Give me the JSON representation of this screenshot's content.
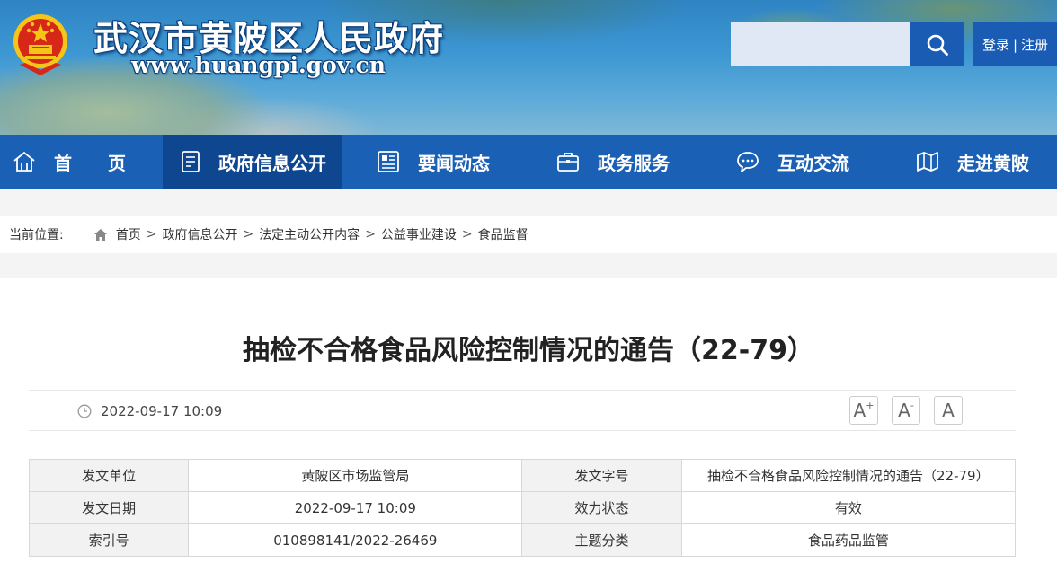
{
  "header": {
    "site_title": "武汉市黄陂区人民政府",
    "site_url": "www.huangpi.gov.cn",
    "search_placeholder": "",
    "login_label": "登录",
    "separator": "|",
    "register_label": "注册"
  },
  "nav": {
    "items": [
      {
        "label": "首　　页",
        "icon": "home-icon"
      },
      {
        "label": "政府信息公开",
        "icon": "document-icon"
      },
      {
        "label": "要闻动态",
        "icon": "news-icon"
      },
      {
        "label": "政务服务",
        "icon": "briefcase-icon"
      },
      {
        "label": "互动交流",
        "icon": "chat-icon"
      },
      {
        "label": "走进黄陂",
        "icon": "map-icon"
      }
    ],
    "active_index": 1
  },
  "breadcrumb": {
    "label": "当前位置:",
    "items": [
      "首页",
      "政府信息公开",
      "法定主动公开内容",
      "公益事业建设",
      "食品监督"
    ],
    "separator": ">"
  },
  "article": {
    "title": "抽检不合格食品风险控制情况的通告（22-79）",
    "date": "2022-09-17 10:09",
    "font_buttons": {
      "increase": "A",
      "decrease": "A",
      "reset": "A",
      "plus": "+",
      "minus": "-"
    }
  },
  "info_table": {
    "rows": [
      [
        "发文单位",
        "黄陂区市场监管局",
        "发文字号",
        "抽检不合格食品风险控制情况的通告（22-79）"
      ],
      [
        "发文日期",
        "2022-09-17 10:09",
        "效力状态",
        "有效"
      ],
      [
        "索引号",
        "010898141/2022-26469",
        "主题分类",
        "食品药品监管"
      ]
    ]
  },
  "colors": {
    "nav_bg": "#1a60b5",
    "nav_active": "#0f4690",
    "search_button": "#1a5cb3"
  }
}
